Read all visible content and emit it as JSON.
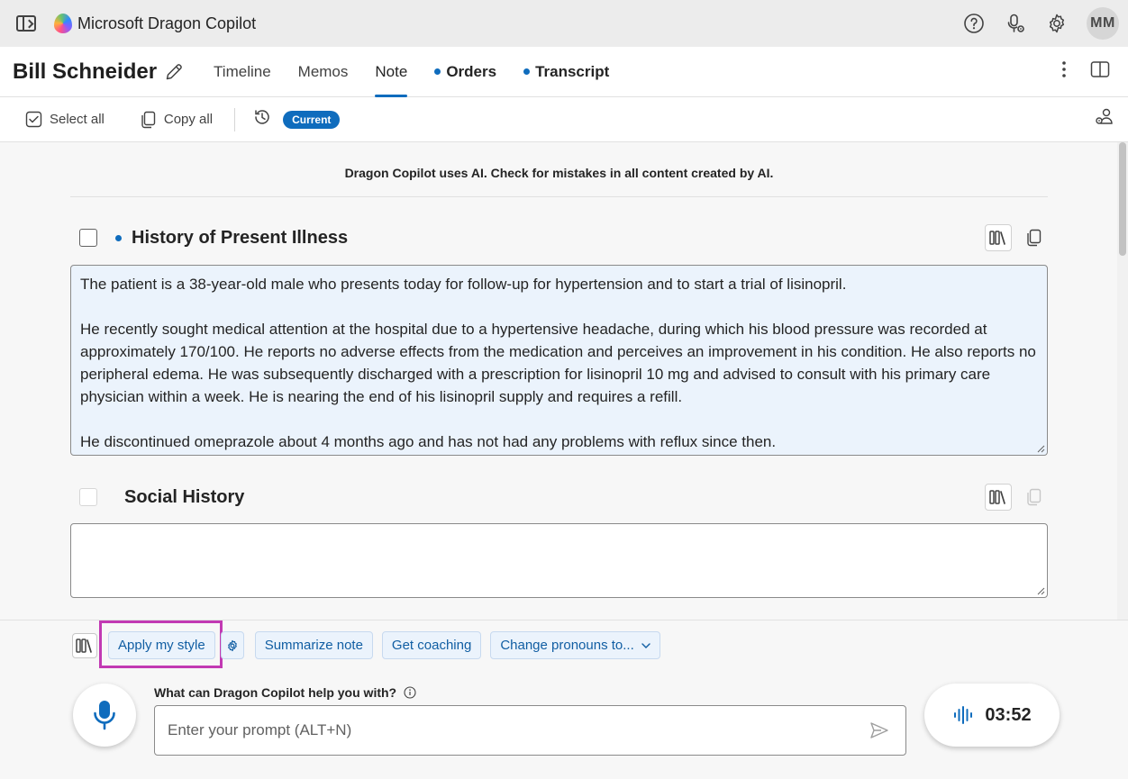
{
  "app": {
    "title": "Microsoft Dragon Copilot",
    "avatar_initials": "MM"
  },
  "header": {
    "patient_name": "Bill Schneider",
    "tabs": [
      {
        "label": "Timeline",
        "active": false,
        "dot": false
      },
      {
        "label": "Memos",
        "active": false,
        "dot": false
      },
      {
        "label": "Note",
        "active": true,
        "dot": false
      },
      {
        "label": "Orders",
        "active": false,
        "dot": true
      },
      {
        "label": "Transcript",
        "active": false,
        "dot": true
      }
    ]
  },
  "toolbar": {
    "select_all": "Select all",
    "copy_all": "Copy all",
    "version_badge": "Current"
  },
  "main": {
    "disclaimer": "Dragon Copilot uses AI. Check for mistakes in all content created by AI.",
    "sections": [
      {
        "title": "History of Present Illness",
        "paragraphs": [
          "The patient is a 38-year-old male who presents today for follow-up for hypertension and to start a trial of lisinopril.",
          "He recently sought medical attention at the hospital due to a hypertensive headache, during which his blood pressure was recorded at approximately 170/100. He reports no adverse effects from the medication and perceives an improvement in his condition. He also reports no peripheral edema. He was subsequently discharged with a prescription for lisinopril 10 mg and advised to consult with his primary care physician within a week. He is nearing the end of his lisinopril supply and requires a refill.",
          "He discontinued omeprazole about 4 months ago and has not had any problems with reflux since then."
        ]
      },
      {
        "title": "Social History",
        "content": ""
      }
    ]
  },
  "bottom": {
    "chips": {
      "apply_style": "Apply my style",
      "summarize": "Summarize note",
      "coaching": "Get coaching",
      "pronouns": "Change pronouns to..."
    },
    "prompt_label": "What can Dragon Copilot help you with?",
    "prompt_placeholder": "Enter your prompt (ALT+N)",
    "timer": "03:52"
  },
  "colors": {
    "accent": "#0f6cbd",
    "highlight": "#c239b3",
    "hpi_bg": "#ebf3fc"
  }
}
